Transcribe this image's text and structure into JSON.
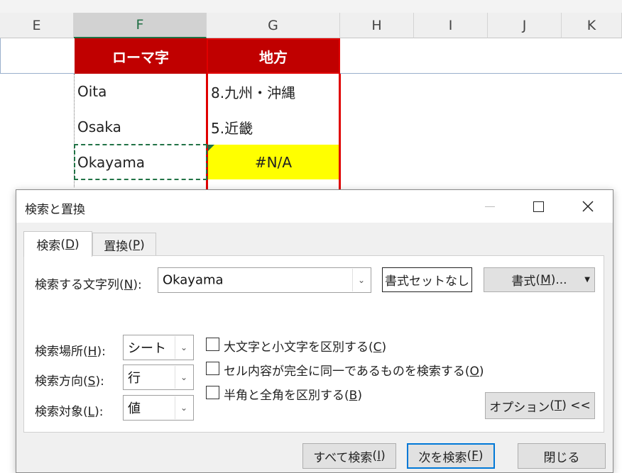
{
  "columns": [
    "E",
    "F",
    "G",
    "H",
    "I",
    "J",
    "K"
  ],
  "table": {
    "headers": [
      "ローマ字",
      "地方"
    ],
    "rows": [
      [
        "Oita",
        "8.九州・沖縄"
      ],
      [
        "Osaka",
        "5.近畿"
      ],
      [
        "Okayama",
        "#N/A"
      ]
    ]
  },
  "dialog": {
    "title": "検索と置換",
    "tabs": [
      {
        "label": "検索",
        "key": "D"
      },
      {
        "label": "置換",
        "key": "P"
      }
    ],
    "find_label": {
      "text": "検索する文字列",
      "key": "N"
    },
    "find_value": "Okayama",
    "no_format_label": "書式セットなし",
    "format_button": {
      "text": "書式",
      "key": "M"
    },
    "within": {
      "label": "検索場所",
      "key": "H",
      "value": "シート"
    },
    "search": {
      "label": "検索方向",
      "key": "S",
      "value": "行"
    },
    "look_in": {
      "label": "検索対象",
      "key": "L",
      "value": "値"
    },
    "options": [
      {
        "label": "大文字と小文字を区別する",
        "key": "C",
        "checked": false
      },
      {
        "label": "セル内容が完全に同一であるものを検索する",
        "key": "O",
        "checked": false
      },
      {
        "label": "半角と全角を区別する",
        "key": "B",
        "checked": false
      }
    ],
    "options_button": {
      "text": "オプション",
      "key": "T",
      "suffix": "<<"
    },
    "footer_buttons": [
      {
        "text": "すべて検索",
        "key": "I"
      },
      {
        "text": "次を検索",
        "key": "F"
      },
      {
        "text": "閉じる"
      }
    ]
  },
  "colors": {
    "header_red": "#c00000",
    "highlight_yellow": "#ffff00",
    "selection_green": "#217346"
  }
}
